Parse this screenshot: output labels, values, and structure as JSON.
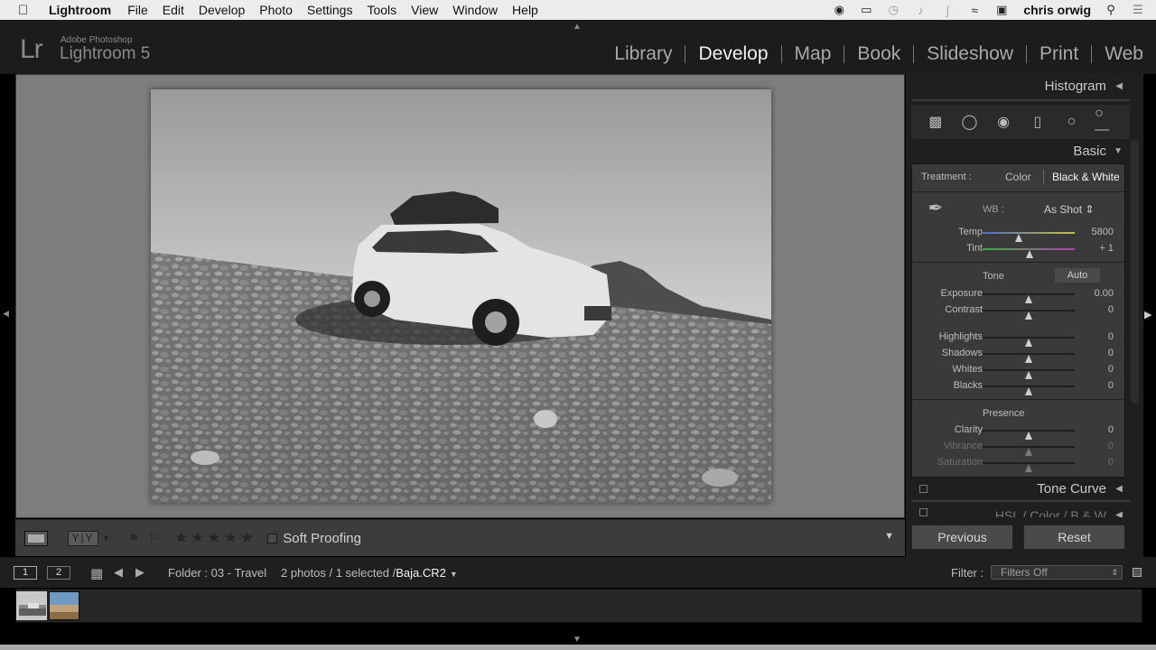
{
  "menubar": {
    "items": [
      "Lightroom",
      "File",
      "Edit",
      "Develop",
      "Photo",
      "Settings",
      "Tools",
      "View",
      "Window",
      "Help"
    ],
    "user": "chris orwig"
  },
  "identity": {
    "small": "Adobe Photoshop",
    "name": "Lightroom 5",
    "logo": "Lr"
  },
  "modules": [
    "Library",
    "Develop",
    "Map",
    "Book",
    "Slideshow",
    "Print",
    "Web"
  ],
  "active_module": "Develop",
  "toolbar": {
    "soft_proofing": "Soft Proofing",
    "yy": "Y|Y"
  },
  "panel": {
    "histogram": "Histogram",
    "basic": "Basic",
    "treatment_label": "Treatment :",
    "treatment_color": "Color",
    "treatment_bw": "Black & White",
    "wb_label": "WB :",
    "wb_value": "As Shot",
    "tone_label": "Tone",
    "auto": "Auto",
    "presence_label": "Presence",
    "tone_curve": "Tone Curve",
    "hsl": "HSL / Color / B & W",
    "previous": "Previous",
    "reset": "Reset",
    "sliders": {
      "temp": {
        "label": "Temp",
        "value": "5800",
        "pos": 0.39
      },
      "tint": {
        "label": "Tint",
        "value": "+ 1",
        "pos": 0.505
      },
      "exposure": {
        "label": "Exposure",
        "value": "0.00",
        "pos": 0.5
      },
      "contrast": {
        "label": "Contrast",
        "value": "0",
        "pos": 0.5
      },
      "highlights": {
        "label": "Highlights",
        "value": "0",
        "pos": 0.5
      },
      "shadows": {
        "label": "Shadows",
        "value": "0",
        "pos": 0.5
      },
      "whites": {
        "label": "Whites",
        "value": "0",
        "pos": 0.5
      },
      "blacks": {
        "label": "Blacks",
        "value": "0",
        "pos": 0.5
      },
      "clarity": {
        "label": "Clarity",
        "value": "0",
        "pos": 0.5
      },
      "vibrance": {
        "label": "Vibrance",
        "value": "0",
        "pos": 0.5
      },
      "saturation": {
        "label": "Saturation",
        "value": "0",
        "pos": 0.5
      }
    }
  },
  "filmnav": {
    "page1": "1",
    "page2": "2",
    "folder": "Folder : 03 - Travel",
    "count": "2 photos / 1 selected /",
    "file": "Baja.CR2",
    "filter_label": "Filter :",
    "filter_value": "Filters Off"
  },
  "icons": {
    "apple": "apple-icon",
    "crop": "crop-overlay-icon",
    "spot": "spot-removal-icon",
    "redeye": "red-eye-icon",
    "gradient": "graduated-filter-icon",
    "radial": "radial-filter-icon",
    "brush": "adjustment-brush-icon"
  }
}
